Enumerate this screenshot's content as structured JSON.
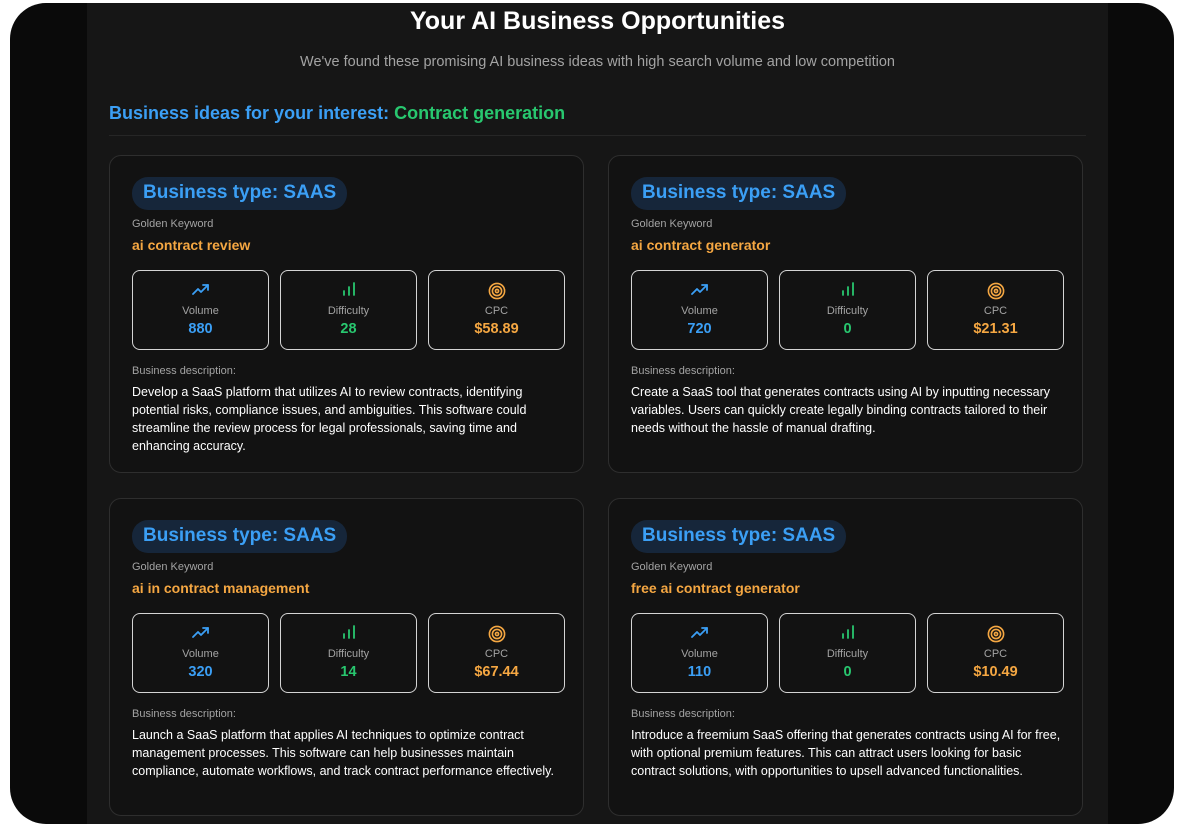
{
  "page": {
    "title": "Your AI Business Opportunities",
    "subtitle": "We've found these promising AI business ideas with high search volume and low competition",
    "interest_label": "Business ideas for your interest:",
    "interest_topic": "Contract generation"
  },
  "labels": {
    "golden_keyword": "Golden Keyword",
    "volume": "Volume",
    "difficulty": "Difficulty",
    "cpc": "CPC",
    "business_description": "Business description:"
  },
  "icons": {
    "volume": "trending-up-icon",
    "difficulty": "bar-chart-icon",
    "cpc": "target-icon"
  },
  "colors": {
    "blue": "#3b9ff5",
    "green": "#28c76f",
    "orange": "#f5a742"
  },
  "cards": [
    {
      "business_type": "Business type: SAAS",
      "keyword": "ai contract review",
      "volume": "880",
      "difficulty": "28",
      "cpc": "$58.89",
      "description": "Develop a SaaS platform that utilizes AI to review contracts, identifying potential risks, compliance issues, and ambiguities. This software could streamline the review process for legal professionals, saving time and enhancing accuracy."
    },
    {
      "business_type": "Business type: SAAS",
      "keyword": "ai contract generator",
      "volume": "720",
      "difficulty": "0",
      "cpc": "$21.31",
      "description": "Create a SaaS tool that generates contracts using AI by inputting necessary variables. Users can quickly create legally binding contracts tailored to their needs without the hassle of manual drafting."
    },
    {
      "business_type": "Business type: SAAS",
      "keyword": "ai in contract management",
      "volume": "320",
      "difficulty": "14",
      "cpc": "$67.44",
      "description": "Launch a SaaS platform that applies AI techniques to optimize contract management processes. This software can help businesses maintain compliance, automate workflows, and track contract performance effectively."
    },
    {
      "business_type": "Business type: SAAS",
      "keyword": "free ai contract generator",
      "volume": "110",
      "difficulty": "0",
      "cpc": "$10.49",
      "description": "Introduce a freemium SaaS offering that generates contracts using AI for free, with optional premium features. This can attract users looking for basic contract solutions, with opportunities to upsell advanced functionalities."
    }
  ]
}
